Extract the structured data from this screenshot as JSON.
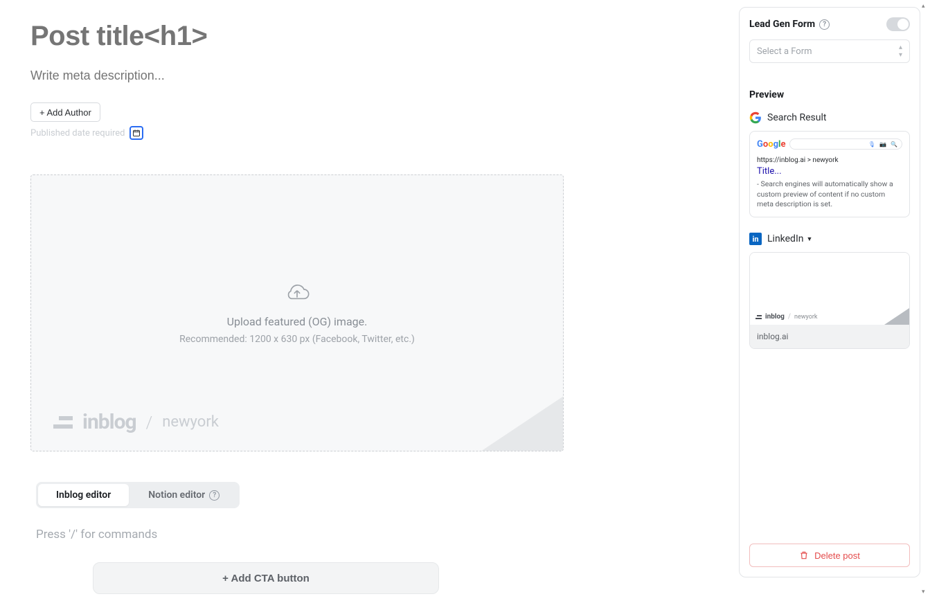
{
  "main": {
    "title_placeholder": "Post title<h1>",
    "meta_placeholder": "Write meta description...",
    "add_author_label": "+ Add Author",
    "published_date_label": "Published date required",
    "og_upload": {
      "line1": "Upload featured (OG) image.",
      "line2": "Recommended: 1200 x 630 px (Facebook, Twitter, etc.)",
      "brand": "inblog",
      "brand_sub": "newyork"
    },
    "editor_tabs": {
      "inblog": "Inblog editor",
      "notion": "Notion editor"
    },
    "commands_placeholder": "Press '/' for commands",
    "cta_button_label": "+ Add CTA button"
  },
  "sidebar": {
    "leadgen_title": "Lead Gen Form",
    "form_select_placeholder": "Select a Form",
    "preview_heading": "Preview",
    "search_result_label": "Search Result",
    "search_card": {
      "crumb": "https://inblog.ai > newyork",
      "title": "Title...",
      "desc": "- Search engines will automatically show a custom preview of content if no custom meta description is set."
    },
    "linkedin_label": "LinkedIn",
    "linkedin_card": {
      "brand": "inblog",
      "brand_sub": "newyork",
      "footer": "inblog.ai"
    },
    "delete_label": "Delete post"
  }
}
